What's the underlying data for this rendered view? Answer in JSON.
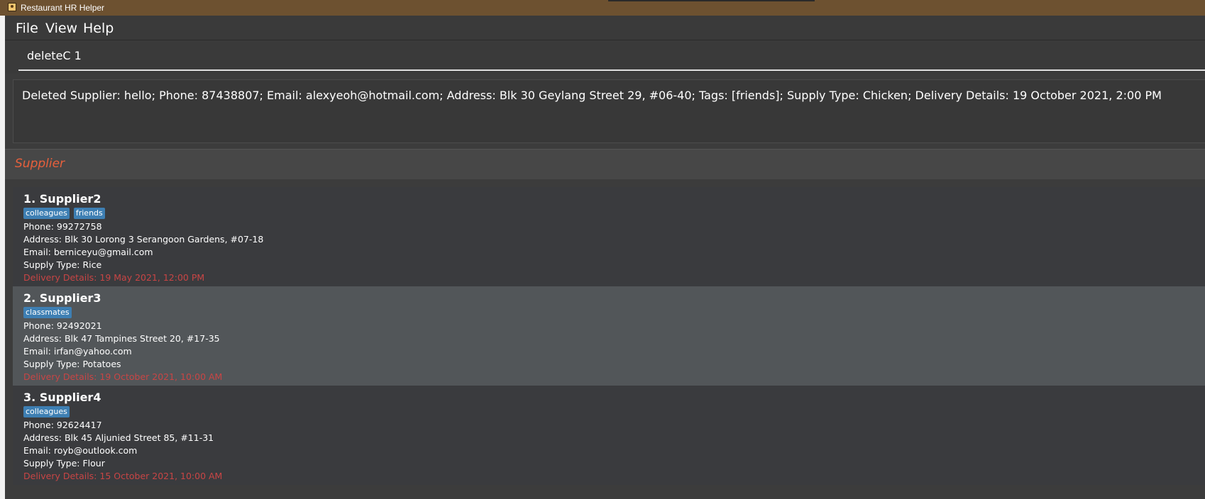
{
  "window": {
    "title": "Restaurant HR Helper"
  },
  "menu": {
    "items": [
      "File",
      "View",
      "Help"
    ]
  },
  "command": {
    "value": "deleteC 1"
  },
  "result": {
    "text": "Deleted Supplier: hello; Phone: 87438807; Email: alexyeoh@hotmail.com; Address: Blk 30 Geylang Street 29, #06-40; Tags: [friends]; Supply Type: Chicken; Delivery Details: 19 October 2021, 2:00 PM"
  },
  "list": {
    "title": "Supplier",
    "cards": [
      {
        "heading": "1.  Supplier2",
        "tags": [
          "colleagues",
          "friends"
        ],
        "phone": "Phone: 99272758",
        "address": "Address: Blk 30 Lorong 3 Serangoon Gardens, #07-18",
        "email": "Email: berniceyu@gmail.com",
        "supply": "Supply Type: Rice",
        "delivery": "Delivery Details: 19 May 2021, 12:00 PM"
      },
      {
        "heading": "2.  Supplier3",
        "tags": [
          "classmates"
        ],
        "phone": "Phone: 92492021",
        "address": "Address: Blk 47 Tampines Street 20, #17-35",
        "email": "Email: irfan@yahoo.com",
        "supply": "Supply Type: Potatoes",
        "delivery": "Delivery Details: 19 October 2021, 10:00 AM"
      },
      {
        "heading": "3.  Supplier4",
        "tags": [
          "colleagues"
        ],
        "phone": "Phone: 92624417",
        "address": "Address: Blk 45 Aljunied Street 85, #11-31",
        "email": "Email: royb@outlook.com",
        "supply": "Supply Type: Flour",
        "delivery": "Delivery Details: 15 October 2021, 10:00 AM"
      }
    ]
  },
  "colors": {
    "titlebar": "#6d5130",
    "background": "#3c3c3c",
    "card_odd": "#3a3b3e",
    "card_selected": "#525659",
    "tag": "#3e7fb3",
    "accent_title": "#e8603c",
    "delivery_text": "#c84545"
  }
}
